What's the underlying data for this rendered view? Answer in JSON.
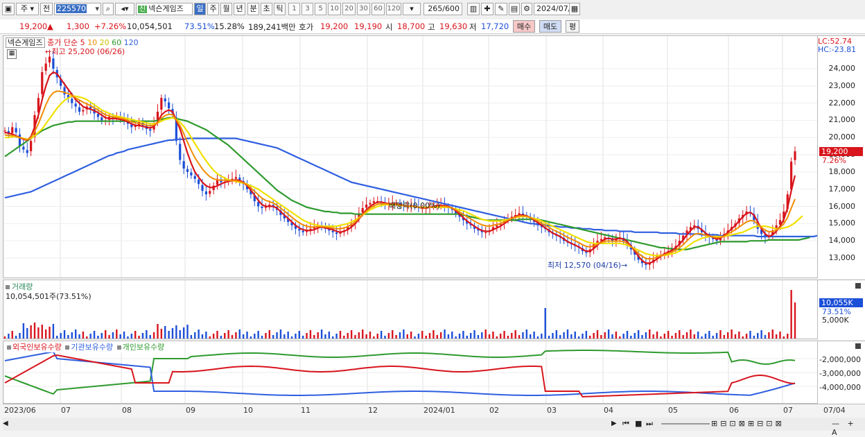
{
  "toolbar": {
    "market": "주",
    "prev": "전",
    "code": "225570",
    "name_tag": "신",
    "name": "넥슨게임즈",
    "periods": [
      "일",
      "주",
      "월",
      "년",
      "분",
      "초",
      "틱"
    ],
    "intervals": [
      "1",
      "3",
      "5",
      "10",
      "20",
      "30",
      "60",
      "120"
    ],
    "count": "265",
    "count_total": "/600",
    "date": "2024/07/04"
  },
  "quote": {
    "price": "19,200",
    "change": "1,300",
    "pct": "+7.26%",
    "volume": "10,054,501",
    "vol_ratio": "73.51%",
    "turnover": "15.28%",
    "amount": "189,241백만",
    "ask_label": "호가",
    "ask": "19,200",
    "bid": "19,190",
    "open_label": "시",
    "open": "18,700",
    "high_label": "고",
    "high": "19,630",
    "low_label": "저",
    "low": "17,720",
    "buy": "매수",
    "sell": "매도",
    "eval": "평"
  },
  "price_panel": {
    "name": "넥슨게임즈",
    "ma_label": "종가 단순",
    "ma": [
      {
        "label": "5",
        "color": "#d8141c"
      },
      {
        "label": "10",
        "color": "#f08c00"
      },
      {
        "label": "20",
        "color": "#e6d800"
      },
      {
        "label": "60",
        "color": "#2e9a2e"
      },
      {
        "label": "120",
        "color": "#2f5fe0"
      }
    ],
    "high_note": "최고 25,200 (06/26)",
    "low_note": "최저 12,570 (04/16)",
    "div_note": "배당락(0.00%)",
    "lc": "LC:52.74",
    "hc": "HC:-23.81",
    "y_ticks": [
      "24,000",
      "23,000",
      "22,000",
      "21,000",
      "20,000",
      "19,000",
      "18,000",
      "17,000",
      "16,000",
      "15,000",
      "14,000",
      "13,000"
    ],
    "last_price": "19,200",
    "last_pct": "7.26%"
  },
  "volume_panel": {
    "title": "거래량",
    "value": "10,054,501주(73.51%)",
    "last": "10,055K",
    "last_pct": "73.51%",
    "tick": "5,000K"
  },
  "holding_panel": {
    "legend": [
      {
        "label": "외국인보유수량",
        "color": "#d8141c"
      },
      {
        "label": "기관보유수량",
        "color": "#2f5fe0"
      },
      {
        "label": "개인보유수량",
        "color": "#2e9a2e"
      }
    ],
    "y_ticks": [
      "-2,000,000",
      "-3,000,000",
      "-4,000,000"
    ]
  },
  "x_axis": [
    "2023/06",
    "07",
    "08",
    "09",
    "10",
    "11",
    "12",
    "2024/01",
    "02",
    "03",
    "04",
    "05",
    "06",
    "07"
  ],
  "x_axis_right": "07/04",
  "chart_data": {
    "type": "candlestick",
    "ylim": [
      12000,
      25500
    ],
    "close": [
      20400,
      20200,
      20600,
      20300,
      19500,
      19300,
      19100,
      19800,
      21300,
      22300,
      23800,
      24300,
      24700,
      24000,
      23500,
      23000,
      22500,
      22300,
      22000,
      21800,
      21500,
      21600,
      21800,
      21700,
      21400,
      21200,
      21000,
      21000,
      21200,
      21100,
      21200,
      21100,
      21000,
      20800,
      20600,
      20700,
      20900,
      20700,
      20500,
      20400,
      20800,
      21500,
      22300,
      22100,
      21700,
      21400,
      19800,
      18700,
      18200,
      18000,
      17800,
      17600,
      17300,
      16900,
      16700,
      16900,
      17200,
      17600,
      17400,
      17400,
      17500,
      17600,
      17700,
      17500,
      17300,
      17000,
      16700,
      16300,
      16000,
      15900,
      16000,
      16100,
      16000,
      15800,
      15500,
      15300,
      15100,
      14900,
      14700,
      14600,
      14500,
      14600,
      14700,
      14800,
      14900,
      14800,
      14700,
      14600,
      14500,
      14400,
      14500,
      14600,
      14800,
      15000,
      15200,
      15600,
      15900,
      16100,
      16200,
      16300,
      16300,
      16200,
      16100,
      16100,
      16200,
      16200,
      16100,
      16000,
      16000,
      16100,
      16000,
      15900,
      15900,
      15900,
      16000,
      16000,
      16100,
      16100,
      16000,
      15900,
      15800,
      15600,
      15400,
      15200,
      15000,
      14900,
      14700,
      14600,
      14500,
      14500,
      14600,
      14800,
      14900,
      15000,
      15200,
      15300,
      15400,
      15500,
      15600,
      15500,
      15400,
      15300,
      15100,
      14900,
      14800,
      14700,
      14500,
      14400,
      14300,
      14200,
      14000,
      13900,
      13800,
      13700,
      13600,
      13400,
      13300,
      13500,
      13800,
      14000,
      14100,
      14200,
      14100,
      14000,
      14100,
      14200,
      14000,
      13800,
      13500,
      13200,
      12900,
      12700,
      12600,
      12700,
      12900,
      13100,
      13200,
      13300,
      13400,
      13500,
      13700,
      14000,
      14300,
      14600,
      14800,
      14900,
      14700,
      14500,
      14300,
      14200,
      14100,
      14000,
      14200,
      14400,
      14600,
      14800,
      15000,
      15300,
      15500,
      15700,
      15600,
      15200,
      14700,
      14400,
      14200,
      14300,
      14600,
      14900,
      15200,
      15700,
      16700,
      18600,
      19200
    ],
    "ma5": [
      20300,
      20250,
      20200,
      20100,
      20000,
      19900,
      19850,
      20050,
      20600,
      21300,
      22200,
      23000,
      23600,
      23800,
      23700,
      23400,
      23100,
      22800,
      22500,
      22200,
      22000,
      21800,
      21700,
      21650,
      21550,
      21450,
      21300,
      21150,
      21100,
      21100,
      21100,
      21050,
      21000,
      20900,
      20800,
      20700,
      20700,
      20650,
      20600,
      20550,
      20650,
      20900,
      21300,
      21500,
      21600,
      21500,
      21000,
      20500,
      19800,
      19100,
      18500,
      18000,
      17700,
      17400,
      17200,
      17100,
      17100,
      17200,
      17300,
      17400,
      17450,
      17500,
      17550,
      17500,
      17400,
      17200,
      16950,
      16650,
      16350,
      16100,
      16000,
      16000,
      16000,
      15900,
      15700,
      15500,
      15300,
      15100,
      14900,
      14750,
      14650,
      14600,
      14600,
      14650,
      14750,
      14800,
      14750,
      14700,
      14650,
      14550,
      14500,
      14550,
      14650,
      14800,
      15000,
      15250,
      15550,
      15800,
      16000,
      16150,
      16250,
      16250,
      16200,
      16150,
      16150,
      16150,
      16100,
      16050,
      16000,
      16000,
      16000,
      15950,
      15900,
      15900,
      15950,
      16000,
      16050,
      16050,
      16050,
      16000,
      15900,
      15750,
      15550,
      15350,
      15150,
      15000,
      14850,
      14700,
      14600,
      14550,
      14550,
      14650,
      14750,
      14850,
      15000,
      15150,
      15300,
      15400,
      15500,
      15500,
      15450,
      15350,
      15200,
      15050,
      14900,
      14750,
      14600,
      14450,
      14350,
      14250,
      14100,
      13950,
      13850,
      13750,
      13650,
      13500,
      13400,
      13400,
      13550,
      13750,
      13950,
      14100,
      14150,
      14100,
      14100,
      14150,
      14100,
      13950,
      13700,
      13400,
      13100,
      12850,
      12700,
      12700,
      12800,
      12950,
      13100,
      13250,
      13350,
      13450,
      13600,
      13800,
      14050,
      14350,
      14600,
      14800,
      14800,
      14650,
      14450,
      14300,
      14200,
      14100,
      14150,
      14300,
      14500,
      14700,
      14900,
      15150,
      15400,
      15600,
      15650,
      15500,
      15100,
      14700,
      14400,
      14250,
      14350,
      14550,
      14850,
      15250,
      15900,
      16900,
      17800
    ],
    "ma20": [
      20000,
      20000,
      20050,
      20050,
      20000,
      19950,
      19900,
      19950,
      20100,
      20300,
      20500,
      20800,
      21100,
      21400,
      21700,
      21950,
      22150,
      22300,
      22400,
      22400,
      22350,
      22300,
      22200,
      22050,
      21900,
      21750,
      21600,
      21500,
      21400,
      21300,
      21250,
      21200,
      21150,
      21100,
      21050,
      21000,
      20950,
      20900,
      20850,
      20800,
      20800,
      20850,
      20950,
      21050,
      21100,
      21150,
      21050,
      20900,
      20650,
      20350,
      20000,
      19650,
      19300,
      18950,
      18650,
      18350,
      18100,
      17900,
      17750,
      17650,
      17550,
      17500,
      17450,
      17400,
      17350,
      17300,
      17200,
      17100,
      17000,
      16850,
      16700,
      16550,
      16400,
      16250,
      16100,
      15950,
      15800,
      15650,
      15500,
      15350,
      15200,
      15100,
      15000,
      14950,
      14900,
      14850,
      14850,
      14850,
      14850,
      14850,
      14900,
      14950,
      15000,
      15100,
      15200,
      15350,
      15500,
      15650,
      15800,
      15900,
      16000,
      16050,
      16100,
      16100,
      16100,
      16100,
      16050,
      16050,
      16000,
      16000,
      16000,
      15950,
      15950,
      15950,
      15950,
      15950,
      15950,
      15950,
      15950,
      15950,
      15900,
      15850,
      15800,
      15750,
      15650,
      15550,
      15450,
      15350,
      15250,
      15200,
      15150,
      15150,
      15150,
      15150,
      15200,
      15250,
      15300,
      15350,
      15400,
      15400,
      15400,
      15350,
      15300,
      15250,
      15150,
      15050,
      14950,
      14850,
      14750,
      14650,
      14550,
      14450,
      14350,
      14250,
      14150,
      14050,
      13950,
      13900,
      13850,
      13850,
      13850,
      13850,
      13850,
      13850,
      13850,
      13850,
      13800,
      13750,
      13650,
      13550,
      13450,
      13350,
      13250,
      13200,
      13150,
      13150,
      13150,
      13150,
      13200,
      13250,
      13300,
      13400,
      13500,
      13650,
      13800,
      13950,
      14050,
      14150,
      14200,
      14250,
      14250,
      14250,
      14250,
      14250,
      14300,
      14350,
      14400,
      14450,
      14500,
      14600,
      14700,
      14800,
      14850,
      14850,
      14850,
      14800,
      14750,
      14700,
      14700,
      14750,
      14800,
      14900,
      15050,
      15250,
      15450
    ],
    "ma60": [
      18900,
      19050,
      19200,
      19350,
      19500,
      19650,
      19800,
      19950,
      20100,
      20250,
      20400,
      20500,
      20600,
      20700,
      20750,
      20800,
      20850,
      20900,
      20900,
      20950,
      20950,
      20950,
      20950,
      20950,
      20950,
      20950,
      20950,
      20950,
      20950,
      20950,
      20950,
      20950,
      20950,
      20950,
      20950,
      20950,
      20950,
      20950,
      20950,
      20950,
      20950,
      21000,
      21050,
      21100,
      21150,
      21150,
      21100,
      21050,
      21000,
      20950,
      20850,
      20750,
      20650,
      20550,
      20450,
      20300,
      20150,
      20000,
      19850,
      19700,
      19550,
      19350,
      19150,
      18950,
      18750,
      18550,
      18350,
      18150,
      17950,
      17750,
      17550,
      17350,
      17150,
      16950,
      16800,
      16650,
      16500,
      16350,
      16250,
      16150,
      16050,
      15950,
      15900,
      15850,
      15800,
      15750,
      15700,
      15700,
      15650,
      15650,
      15600,
      15600,
      15600,
      15600,
      15550,
      15550,
      15550,
      15550,
      15550,
      15550,
      15550,
      15550,
      15550,
      15550,
      15550,
      15550,
      15550,
      15550,
      15550,
      15550,
      15550,
      15550,
      15550,
      15550,
      15550,
      15550,
      15550,
      15550,
      15550,
      15550,
      15550,
      15550,
      15550,
      15500,
      15450,
      15400,
      15350,
      15300,
      15250,
      15200,
      15200,
      15200,
      15200,
      15200,
      15200,
      15200,
      15200,
      15200,
      15250,
      15250,
      15250,
      15250,
      15250,
      15250,
      15200,
      15150,
      15100,
      15050,
      15000,
      14950,
      14900,
      14850,
      14800,
      14750,
      14700,
      14650,
      14600,
      14550,
      14500,
      14450,
      14400,
      14350,
      14300,
      14250,
      14200,
      14150,
      14100,
      14050,
      14000,
      13950,
      13900,
      13850,
      13800,
      13750,
      13700,
      13650,
      13600,
      13600,
      13550,
      13550,
      13500,
      13500,
      13500,
      13500,
      13550,
      13600,
      13650,
      13700,
      13750,
      13800,
      13850,
      13900,
      13950,
      13950,
      13950,
      13950,
      13950,
      13950,
      13950,
      13950,
      14000,
      14000,
      14000,
      14000,
      14000,
      14050,
      14050,
      14050,
      14050,
      14050,
      14050,
      14050,
      14050,
      14050,
      14100,
      14150,
      14200
    ],
    "ma120": [
      16500,
      16550,
      16600,
      16650,
      16700,
      16750,
      16800,
      16850,
      16950,
      17050,
      17150,
      17250,
      17350,
      17450,
      17550,
      17650,
      17750,
      17850,
      17950,
      18050,
      18150,
      18250,
      18350,
      18450,
      18550,
      18650,
      18750,
      18850,
      18950,
      19000,
      19100,
      19150,
      19200,
      19300,
      19350,
      19400,
      19450,
      19500,
      19550,
      19600,
      19650,
      19700,
      19750,
      19800,
      19850,
      19850,
      19900,
      19900,
      19900,
      19950,
      19950,
      19950,
      19950,
      19950,
      19950,
      19950,
      19950,
      19950,
      19950,
      19950,
      19950,
      19950,
      19950,
      19900,
      19850,
      19800,
      19750,
      19700,
      19650,
      19600,
      19550,
      19500,
      19450,
      19400,
      19300,
      19200,
      19100,
      19000,
      18900,
      18800,
      18700,
      18600,
      18500,
      18400,
      18300,
      18200,
      18100,
      18000,
      17900,
      17800,
      17700,
      17600,
      17500,
      17400,
      17350,
      17300,
      17250,
      17200,
      17150,
      17100,
      17050,
      17000,
      16950,
      16900,
      16850,
      16800,
      16750,
      16700,
      16650,
      16600,
      16550,
      16500,
      16450,
      16400,
      16350,
      16300,
      16250,
      16200,
      16150,
      16100,
      16050,
      16000,
      15950,
      15900,
      15850,
      15800,
      15750,
      15700,
      15650,
      15600,
      15550,
      15500,
      15450,
      15400,
      15350,
      15300,
      15250,
      15200,
      15150,
      15100,
      15050,
      15000,
      15000,
      14950,
      14950,
      14900,
      14900,
      14850,
      14850,
      14800,
      14800,
      14800,
      14750,
      14750,
      14750,
      14700,
      14700,
      14700,
      14650,
      14650,
      14650,
      14600,
      14600,
      14600,
      14600,
      14550,
      14550,
      14550,
      14550,
      14500,
      14500,
      14500,
      14500,
      14500,
      14500,
      14500,
      14450,
      14450,
      14450,
      14450,
      14450,
      14400,
      14400,
      14400,
      14400,
      14400,
      14400,
      14350,
      14350,
      14350,
      14350,
      14350,
      14300,
      14300,
      14300,
      14300,
      14300,
      14300,
      14300,
      14300,
      14300,
      14300,
      14250,
      14250,
      14250,
      14250,
      14250,
      14250,
      14250,
      14250,
      14250,
      14250,
      14250,
      14250,
      14250,
      14250,
      14250,
      14250,
      14300
    ]
  }
}
